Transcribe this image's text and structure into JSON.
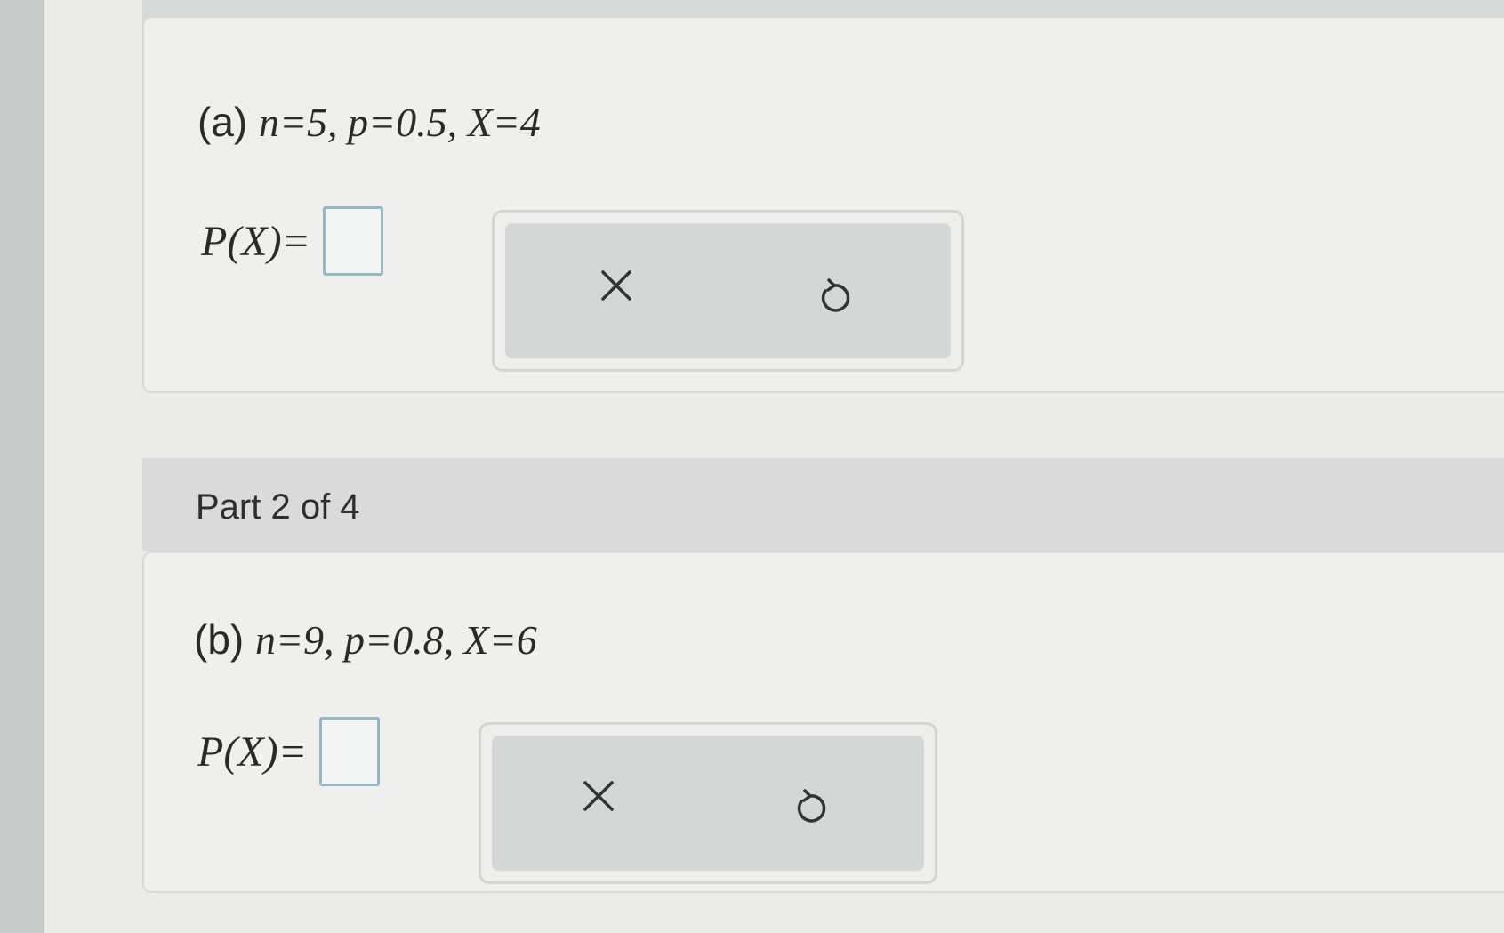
{
  "part_a": {
    "tag": "(a)",
    "expr": "n=5, p=0.5, X=4",
    "answer_label": "P(X)=",
    "answer_value": ""
  },
  "part_header": {
    "label": "Part 2 of 4"
  },
  "part_b": {
    "tag": "(b)",
    "expr": "n=9, p=0.8, X=6",
    "answer_label": "P(X)=",
    "answer_value": ""
  },
  "toolbar": {
    "clear_icon": "close-icon",
    "undo_icon": "undo-icon"
  },
  "colors": {
    "input_border": "#8fb9c6",
    "toolbar_bg": "#d5d7d6"
  }
}
